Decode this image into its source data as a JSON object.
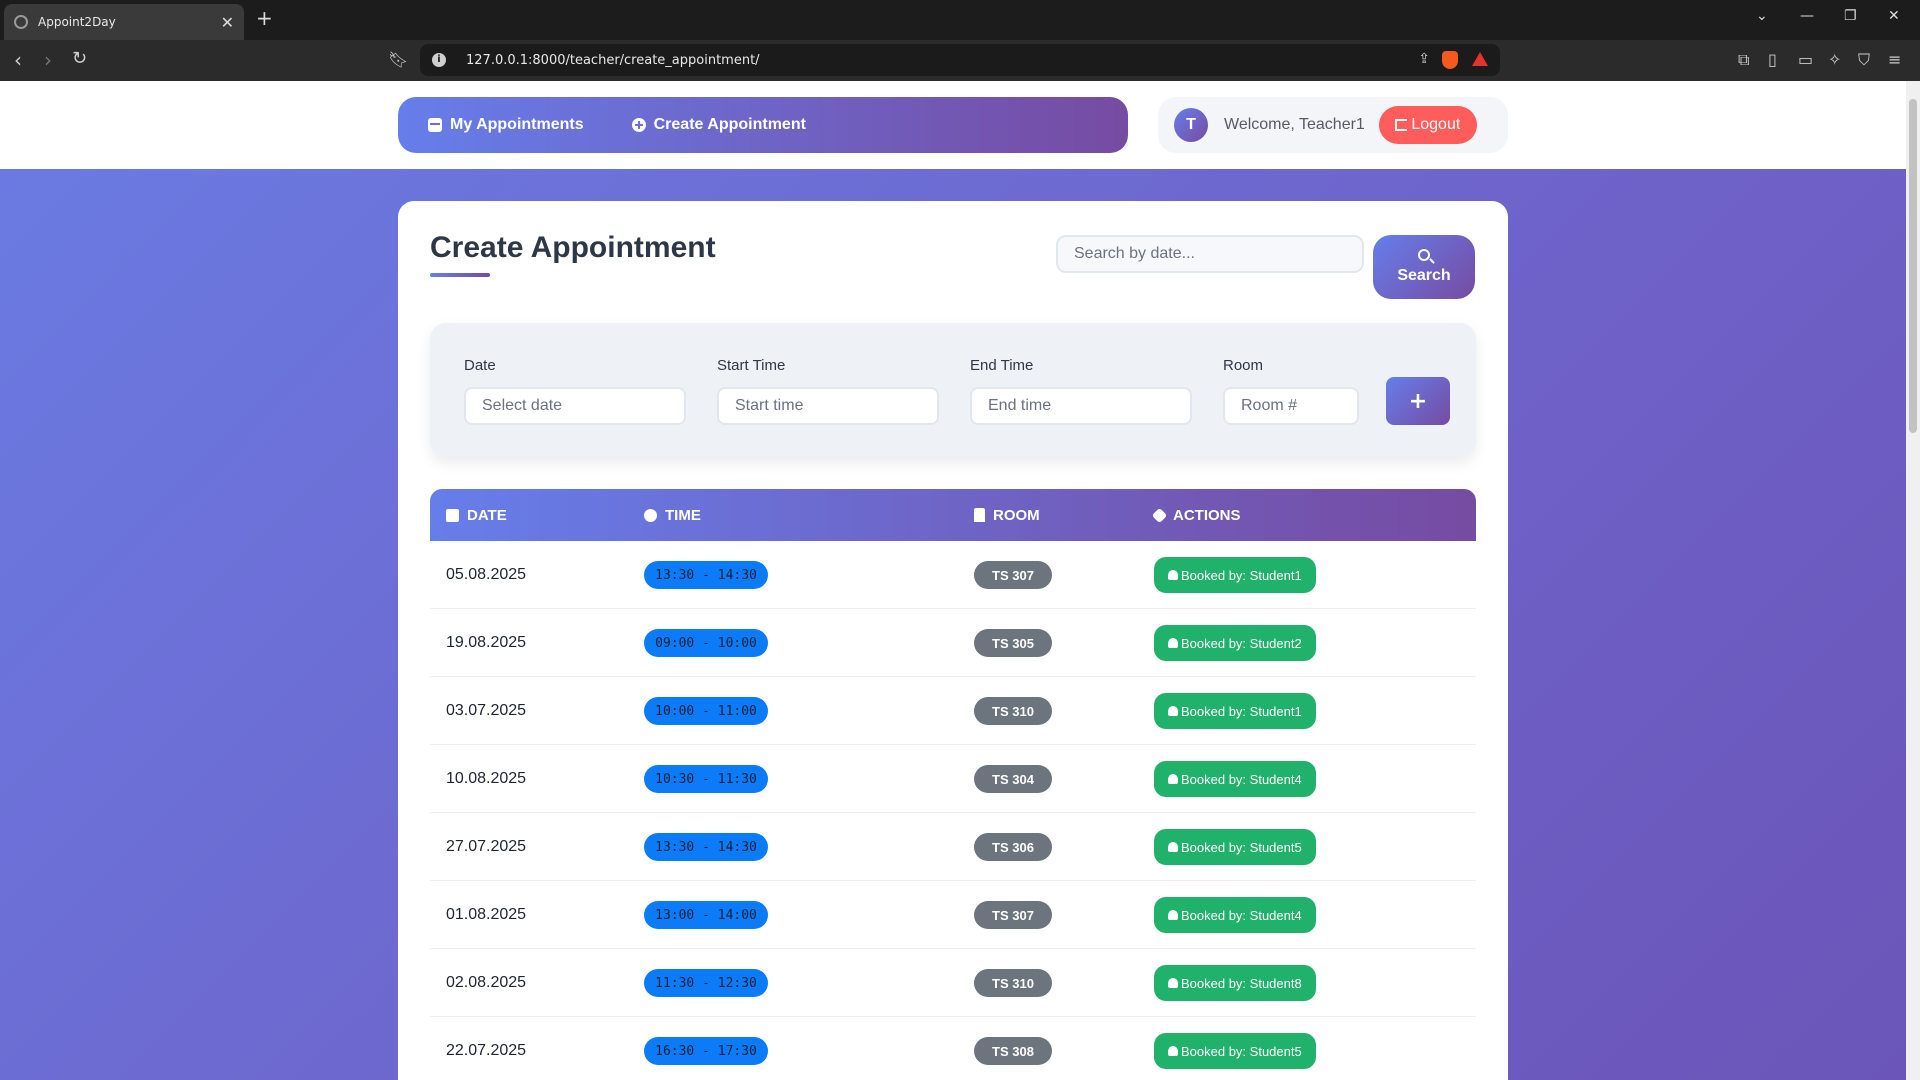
{
  "browser": {
    "tab_title": "Appoint2Day",
    "url": "127.0.0.1:8000/teacher/create_appointment/"
  },
  "nav": {
    "my_appointments": "My Appointments",
    "create_appointment": "Create Appointment"
  },
  "user": {
    "avatar_initial": "T",
    "welcome": "Welcome, Teacher1",
    "logout": "Logout"
  },
  "page": {
    "title": "Create Appointment",
    "search_placeholder": "Search by date...",
    "search_button": "Search"
  },
  "form": {
    "date_label": "Date",
    "date_placeholder": "Select date",
    "start_label": "Start Time",
    "start_placeholder": "Start time",
    "end_label": "End Time",
    "end_placeholder": "End time",
    "room_label": "Room",
    "room_placeholder": "Room #",
    "add_button": "+"
  },
  "table": {
    "headers": {
      "date": "Date",
      "time": "Time",
      "room": "Room",
      "actions": "Actions"
    },
    "rows": [
      {
        "date": "05.08.2025",
        "time": "13:30 - 14:30",
        "room": "TS 307",
        "action": "Booked by: Student1"
      },
      {
        "date": "19.08.2025",
        "time": "09:00 - 10:00",
        "room": "TS 305",
        "action": "Booked by: Student2"
      },
      {
        "date": "03.07.2025",
        "time": "10:00 - 11:00",
        "room": "TS 310",
        "action": "Booked by: Student1"
      },
      {
        "date": "10.08.2025",
        "time": "10:30 - 11:30",
        "room": "TS 304",
        "action": "Booked by: Student4"
      },
      {
        "date": "27.07.2025",
        "time": "13:30 - 14:30",
        "room": "TS 306",
        "action": "Booked by: Student5"
      },
      {
        "date": "01.08.2025",
        "time": "13:00 - 14:00",
        "room": "TS 307",
        "action": "Booked by: Student4"
      },
      {
        "date": "02.08.2025",
        "time": "11:30 - 12:30",
        "room": "TS 310",
        "action": "Booked by: Student8"
      },
      {
        "date": "22.07.2025",
        "time": "16:30 - 17:30",
        "room": "TS 308",
        "action": "Booked by: Student5"
      }
    ]
  },
  "colors": {
    "gradient_start": "#667eea",
    "gradient_end": "#764ba2",
    "time_badge": "#0b7bf7",
    "room_badge": "#6c757d",
    "booked_badge": "#20b26b",
    "logout": "#ff5c5c"
  }
}
